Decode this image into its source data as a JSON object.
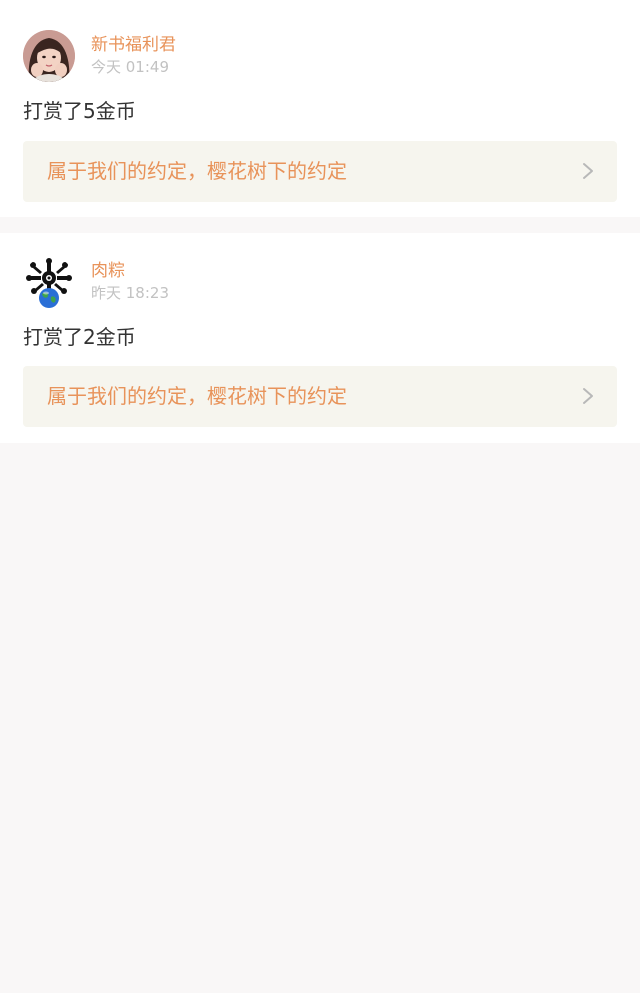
{
  "colors": {
    "accent": "#e8935a",
    "timestamp": "#c2c2c2",
    "text": "#333333",
    "book_bg": "#f6f5ee",
    "page_bg": "#f9f7f7",
    "card_bg": "#ffffff"
  },
  "items": [
    {
      "username": "新书福利君",
      "time": "今天 01:49",
      "reward": "打赏了5金币",
      "book_title": "属于我们的约定，樱花树下的约定",
      "avatar_icon": "girl-portrait-avatar",
      "link_icon": "chevron-right-icon"
    },
    {
      "username": "肉粽",
      "time": "昨天 18:23",
      "reward": "打赏了2金币",
      "book_title": "属于我们的约定，樱花树下的约定",
      "avatar_icon": "earth-avatar",
      "link_icon": "chevron-right-icon"
    }
  ]
}
